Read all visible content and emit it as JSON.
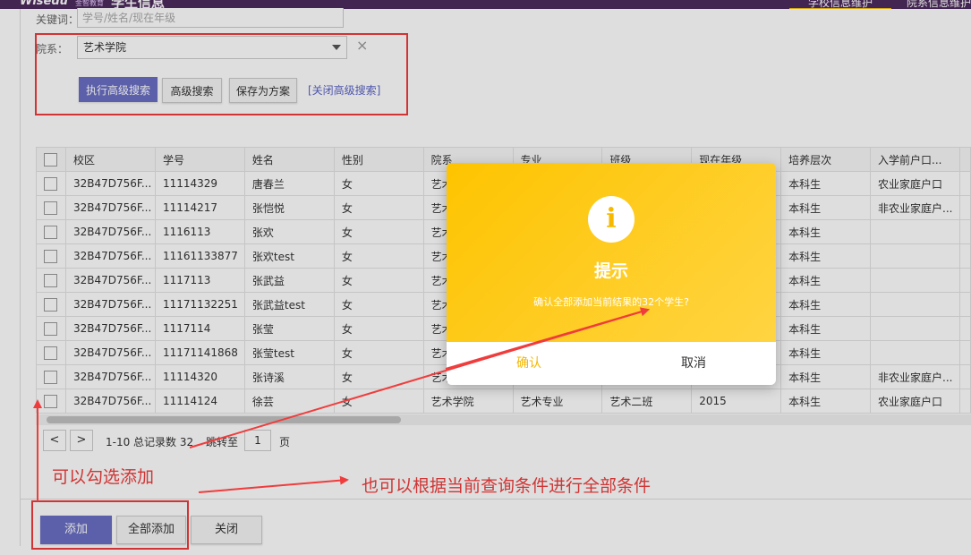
{
  "header": {
    "brand": "Wisedu",
    "brand_sub": "金智教育",
    "system_title": "学生信息",
    "tabs": [
      "学校信息维护",
      "院系信息维护"
    ]
  },
  "search": {
    "keyword_label": "关键词：",
    "keyword_placeholder": "学号/姓名/现在年级",
    "dept_label": "院系：",
    "dept_value": "艺术学院",
    "clear_symbol": "×",
    "buttons": {
      "execute": "执行高级搜索",
      "advanced": "高级搜索",
      "save_plan": "保存为方案",
      "close_advanced": "[关闭高级搜索]"
    }
  },
  "table": {
    "columns": [
      "校区",
      "学号",
      "姓名",
      "性别",
      "院系",
      "专业",
      "班级",
      "现在年级",
      "培养层次",
      "入学前户口...",
      ""
    ],
    "rows": [
      [
        "32B47D756F...",
        "11114329",
        "唐春兰",
        "女",
        "艺术",
        "",
        "",
        "",
        "本科生",
        "农业家庭户口"
      ],
      [
        "32B47D756F...",
        "11114217",
        "张恺悦",
        "女",
        "艺术",
        "",
        "",
        "",
        "本科生",
        "非农业家庭户..."
      ],
      [
        "32B47D756F...",
        "1116113",
        "张欢",
        "女",
        "艺术",
        "",
        "",
        "",
        "本科生",
        ""
      ],
      [
        "32B47D756F...",
        "11161133877",
        "张欢test",
        "女",
        "艺术",
        "",
        "",
        "",
        "本科生",
        ""
      ],
      [
        "32B47D756F...",
        "1117113",
        "张武益",
        "女",
        "艺术",
        "",
        "",
        "",
        "本科生",
        ""
      ],
      [
        "32B47D756F...",
        "11171132251",
        "张武益test",
        "女",
        "艺术",
        "",
        "",
        "",
        "本科生",
        ""
      ],
      [
        "32B47D756F...",
        "1117114",
        "张莹",
        "女",
        "艺术",
        "",
        "",
        "",
        "本科生",
        ""
      ],
      [
        "32B47D756F...",
        "11171141868",
        "张莹test",
        "女",
        "艺术",
        "",
        "",
        "",
        "本科生",
        ""
      ],
      [
        "32B47D756F...",
        "11114320",
        "张诗溪",
        "女",
        "艺术",
        "",
        "",
        "",
        "本科生",
        "非农业家庭户..."
      ],
      [
        "32B47D756F...",
        "11114124",
        "徐芸",
        "女",
        "艺术学院",
        "艺术专业",
        "艺术二班",
        "2015",
        "本科生",
        "农业家庭户口"
      ]
    ]
  },
  "pagination": {
    "prev": "<",
    "next": ">",
    "summary": "1-10 总记录数 32",
    "jump_label": "跳转至",
    "page_value": "1",
    "page_unit": "页"
  },
  "footer": {
    "add": "添加",
    "add_all": "全部添加",
    "close": "关闭"
  },
  "annotations": {
    "left": "可以勾选添加",
    "right": "也可以根据当前查询条件进行全部条件"
  },
  "dialog": {
    "icon_glyph": "i",
    "title": "提示",
    "message": "确认全部添加当前结果的32个学生?",
    "confirm": "确认",
    "cancel": "取消"
  },
  "colors": {
    "topbar": "#4d2b5e",
    "primary_button": "#6a6fc4",
    "dialog_yellow": "#fec400",
    "annotation_red": "#f03c3c"
  }
}
